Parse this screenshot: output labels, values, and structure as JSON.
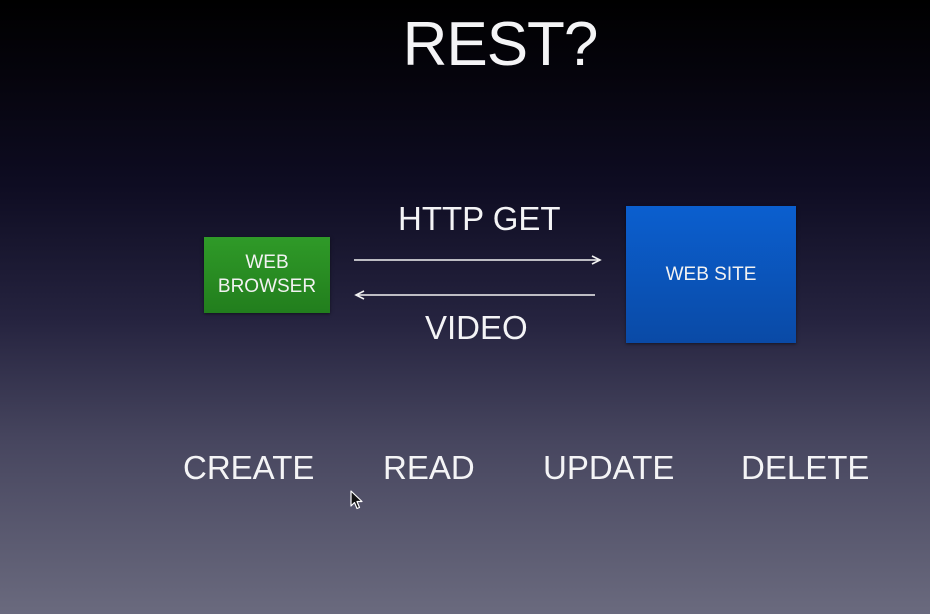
{
  "slide": {
    "title": "REST?"
  },
  "diagram": {
    "client": {
      "line1": "WEB",
      "line2": "BROWSER",
      "color": "#2a8c24"
    },
    "server": {
      "label": "WEB SITE",
      "color": "#0b56bd"
    },
    "request_label": "HTTP GET",
    "response_label": "VIDEO"
  },
  "operations": [
    "CREATE",
    "READ",
    "UPDATE",
    "DELETE"
  ],
  "icons": {
    "cursor": "mouse-pointer-icon"
  }
}
